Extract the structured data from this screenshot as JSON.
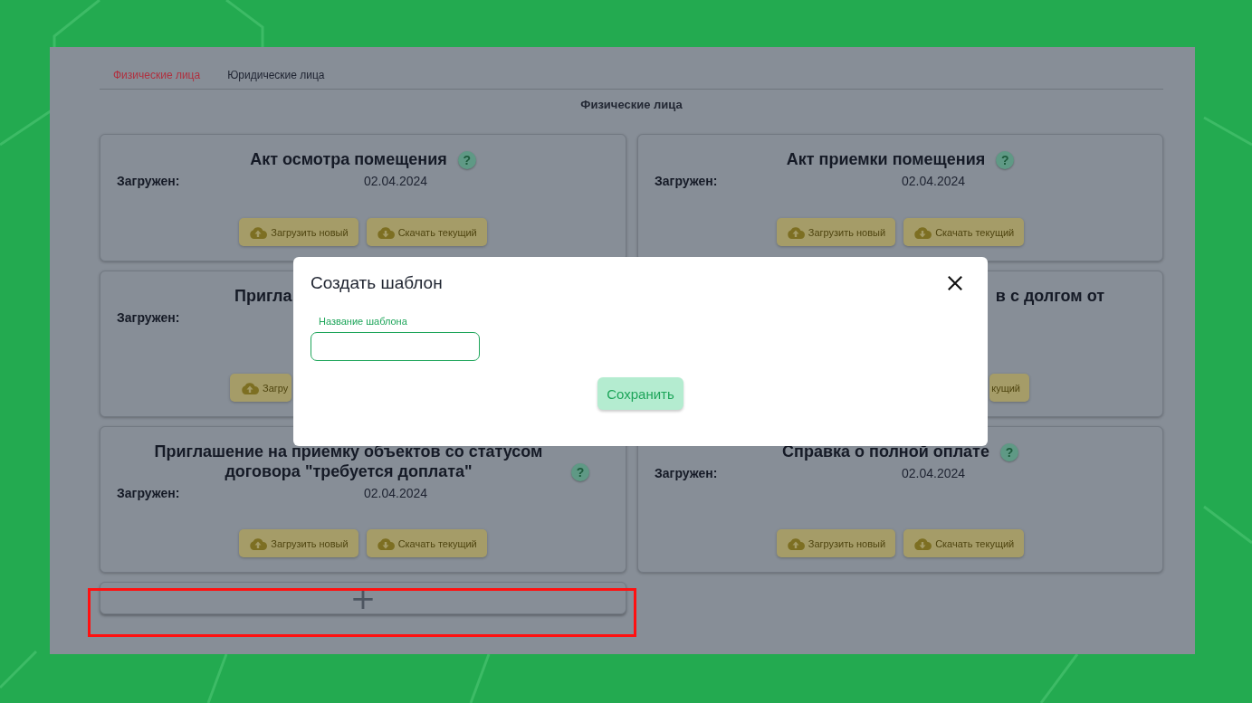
{
  "tabs": [
    {
      "label": "Физические лица",
      "selected": true
    },
    {
      "label": "Юридические лица",
      "selected": false
    }
  ],
  "section_title": "Физические лица",
  "cards": [
    {
      "kind": "full",
      "title": "Акт осмотра помещения",
      "help": "?",
      "uploaded_label": "Загружен:",
      "date": "02.04.2024",
      "buttons": [
        {
          "label": "Загрузить новый",
          "kind": "upload"
        },
        {
          "label": "Скачать текущий",
          "kind": "download"
        }
      ]
    },
    {
      "kind": "full",
      "title": "Акт приемки помещения",
      "help": "?",
      "uploaded_label": "Загружен:",
      "date": "02.04.2024",
      "buttons": [
        {
          "label": "Загрузить новый",
          "kind": "upload"
        },
        {
          "label": "Скачать текущий",
          "kind": "download"
        }
      ]
    },
    {
      "kind": "left_part",
      "title": "Пригла",
      "uploaded_label": "Загружен:",
      "buttons": [
        {
          "label": "Загру",
          "kind": "upload"
        }
      ]
    },
    {
      "kind": "right_part",
      "title": "в с долгом от",
      "buttons": [
        {
          "label": "кущий",
          "kind": "plain"
        }
      ]
    },
    {
      "kind": "full",
      "title": "Приглашение на приемку объектов со статусом договора \"требуется доплата\"",
      "help": "?",
      "uploaded_label": "Загружен:",
      "date": "02.04.2024",
      "buttons": [
        {
          "label": "Загрузить новый",
          "kind": "upload"
        },
        {
          "label": "Скачать текущий",
          "kind": "download"
        }
      ]
    },
    {
      "kind": "full",
      "title": "Справка о полной оплате",
      "help": "?",
      "uploaded_label": "Загружен:",
      "date": "02.04.2024",
      "buttons": [
        {
          "label": "Загрузить новый",
          "kind": "upload"
        },
        {
          "label": "Скачать текущий",
          "kind": "download"
        }
      ]
    }
  ],
  "add_button": "+",
  "modal": {
    "title": "Создать шаблон",
    "field_label": "Название шаблона",
    "save": "Сохранить"
  }
}
